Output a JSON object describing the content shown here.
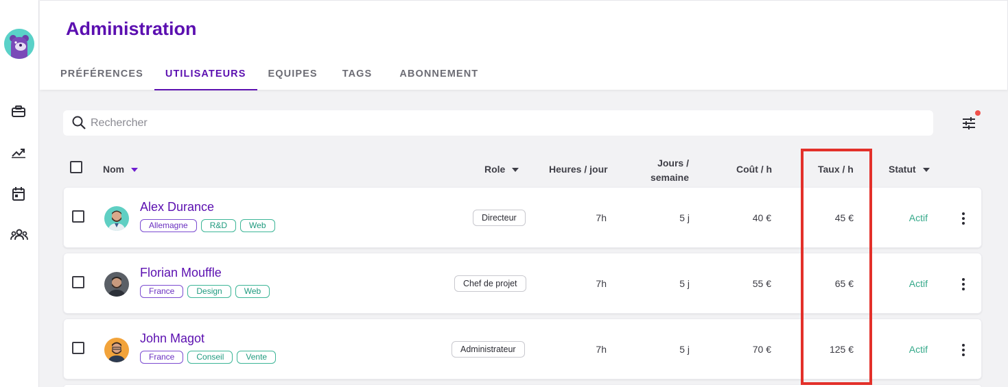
{
  "header": {
    "title": "Administration",
    "tabs": [
      {
        "label": "PRÉFÉRENCES",
        "active": false
      },
      {
        "label": "UTILISATEURS",
        "active": true
      },
      {
        "label": "EQUIPES",
        "active": false
      },
      {
        "label": "TAGS",
        "active": false
      },
      {
        "label": "ABONNEMENT",
        "active": false
      }
    ]
  },
  "sidebar": {
    "logo": "bear-avatar-logo",
    "icons": [
      "briefcase-icon",
      "trending-up-icon",
      "calendar-icon",
      "team-icon"
    ]
  },
  "search": {
    "placeholder": "Rechercher",
    "value": ""
  },
  "filter": {
    "icon": "sliders-icon",
    "has_notification": true
  },
  "table": {
    "columns": {
      "name": "Nom",
      "role": "Role",
      "hours": "Heures / jour",
      "days_1": "Jours /",
      "days_2": "semaine",
      "cost": "Coût / h",
      "rate": "Taux / h",
      "status": "Statut"
    },
    "rows": [
      {
        "name": "Alex Durance",
        "tags": [
          "Allemagne",
          "R&D",
          "Web"
        ],
        "role": "Directeur",
        "hours": "7h",
        "days": "5 j",
        "cost": "40 €",
        "rate": "45 €",
        "status": "Actif"
      },
      {
        "name": "Florian Mouffle",
        "tags": [
          "France",
          "Design",
          "Web"
        ],
        "role": "Chef de projet",
        "hours": "7h",
        "days": "5 j",
        "cost": "55 €",
        "rate": "65 €",
        "status": "Actif"
      },
      {
        "name": "John Magot",
        "tags": [
          "France",
          "Conseil",
          "Vente"
        ],
        "role": "Administrateur",
        "hours": "7h",
        "days": "5 j",
        "cost": "70 €",
        "rate": "125 €",
        "status": "Actif"
      }
    ]
  },
  "colors": {
    "accent": "#5b0fb0",
    "status_active": "#33a889",
    "highlight": "#e3302a",
    "tag_green": "#1e9a7e",
    "tag_purple": "#6a2fc0"
  }
}
